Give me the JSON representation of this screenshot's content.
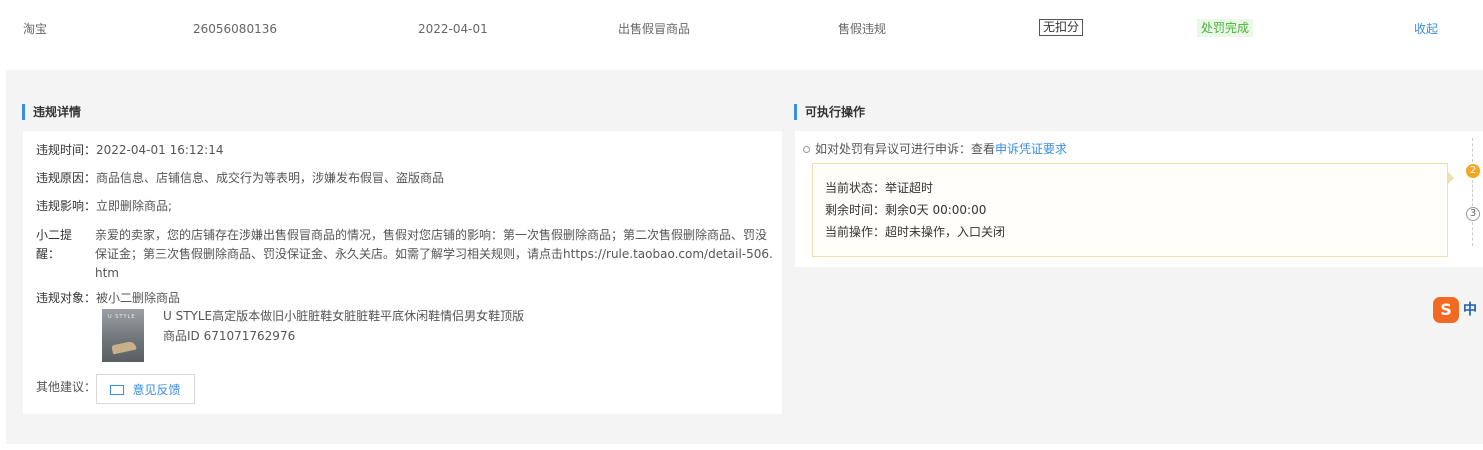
{
  "top_row": {
    "platform": "淘宝",
    "id": "26056080136",
    "date": "2022-04-01",
    "violation_type": "出售假冒商品",
    "category": "售假违规",
    "deduction": "无扣分",
    "status": "处罚完成",
    "collapse": "收起"
  },
  "details": {
    "title": "违规详情",
    "time_label": "违规时间：",
    "time_value": "2022-04-01 16:12:14",
    "reason_label": "违规原因：",
    "reason_value": "商品信息、店铺信息、成交行为等表明，涉嫌发布假冒、盗版商品",
    "impact_label": "违规影响：",
    "impact_value": "立即删除商品;",
    "reminder_label": "小二提醒：",
    "reminder_value": "亲爱的卖家，您的店铺存在涉嫌出售假冒商品的情况，售假对您店铺的影响：第一次售假删除商品；第二次售假删除商品、罚没保证金；第三次售假删除商品、罚没保证金、永久关店。如需了解学习相关规则，请点击https://rule.taobao.com/detail-506.htm",
    "object_label": "违规对象：",
    "object_value": "被小二删除商品",
    "product_image_text": "U STYLE",
    "product_name": "U STYLE高定版本做旧小脏脏鞋女脏脏鞋平底休闲鞋情侣男女鞋顶版",
    "product_id": "商品ID 671071762976",
    "suggest_label": "其他建议：",
    "feedback_button": "意见反馈"
  },
  "operations": {
    "title": "可执行操作",
    "appeal_text": "如对处罚有异议可进行申诉：查看",
    "appeal_link": "申诉凭证要求",
    "status_line": "当前状态：举证超时",
    "remaining_line": "剩余时间：剩余0天 00:00:00",
    "operation_line": "当前操作：超时未操作，入口关闭",
    "step_current": "2",
    "step_next": "3"
  },
  "ime": {
    "logo": "S",
    "lang": "中"
  }
}
